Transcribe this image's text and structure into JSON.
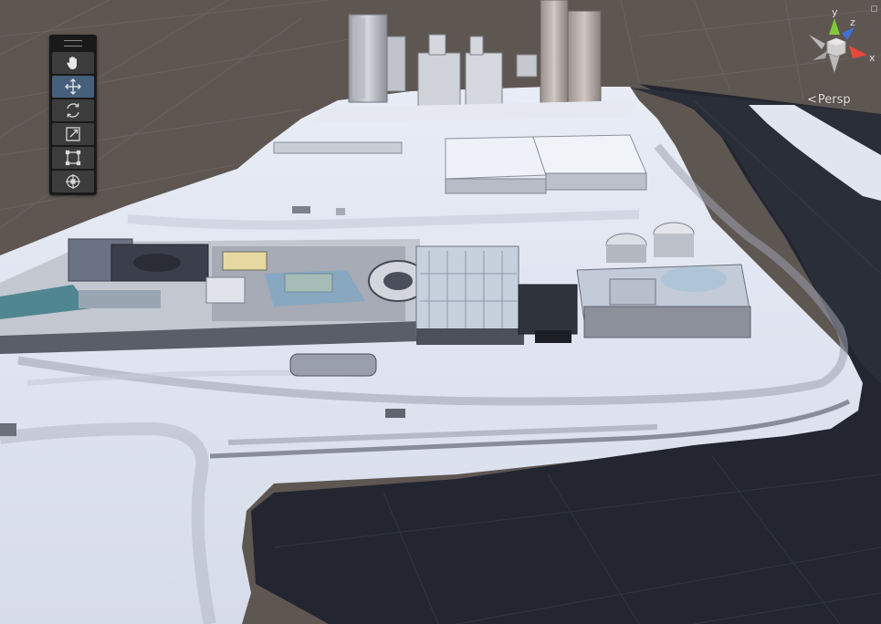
{
  "scene_view": {
    "camera_mode": "Persp",
    "tools": [
      {
        "id": "hand",
        "icon": "hand-icon",
        "active": false
      },
      {
        "id": "move",
        "icon": "move-icon",
        "active": true
      },
      {
        "id": "rotate",
        "icon": "rotate-icon",
        "active": false
      },
      {
        "id": "scale",
        "icon": "scale-icon",
        "active": false
      },
      {
        "id": "rect",
        "icon": "rect-transform-icon",
        "active": false
      },
      {
        "id": "transform",
        "icon": "transform-icon",
        "active": false
      }
    ],
    "gizmo": {
      "x_label": "x",
      "y_label": "y",
      "z_label": "z",
      "x_color": "#e8483a",
      "y_color": "#7fc93a",
      "z_color": "#3f72d6"
    },
    "colors": {
      "background": "#5e5651",
      "terrain": "#dfe4f0",
      "water": "#232630",
      "active_tool": "#46607c"
    }
  }
}
